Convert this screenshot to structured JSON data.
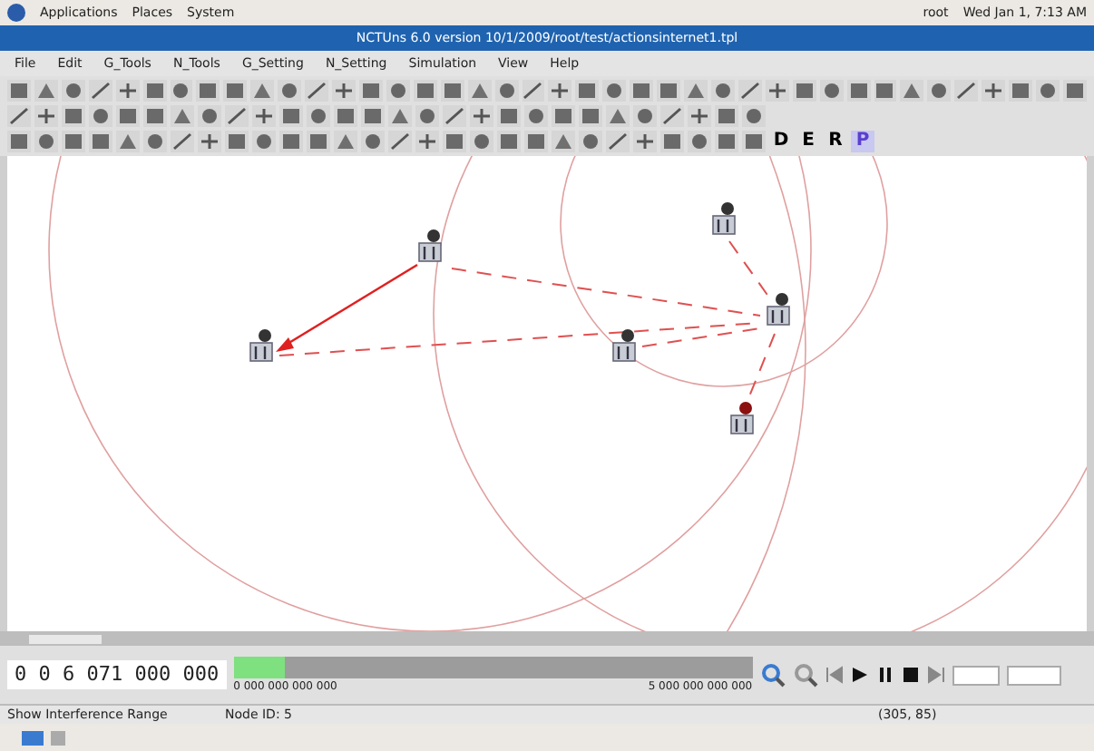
{
  "top_panel": {
    "menus": [
      "Applications",
      "Places",
      "System"
    ],
    "user": "root",
    "clock": "Wed Jan 1, 7:13 AM"
  },
  "window": {
    "title": "NCTUns 6.0 version 10/1/2009/root/test/actionsinternet1.tpl"
  },
  "menu": [
    "File",
    "Edit",
    "G_Tools",
    "N_Tools",
    "G_Setting",
    "N_Setting",
    "Simulation",
    "View",
    "Help"
  ],
  "modes": [
    {
      "label": "D",
      "selected": false
    },
    {
      "label": "E",
      "selected": false
    },
    {
      "label": "R",
      "selected": false
    },
    {
      "label": "P",
      "selected": true
    }
  ],
  "timeline": {
    "time": "0 0 6 071 000 000",
    "start": "0 000 000 000 000",
    "end": "5 000 000 000 000",
    "level": 0.1
  },
  "status_bar": [
    "Show Interference Range",
    "Node ID: 5",
    "(305, 85)"
  ]
}
